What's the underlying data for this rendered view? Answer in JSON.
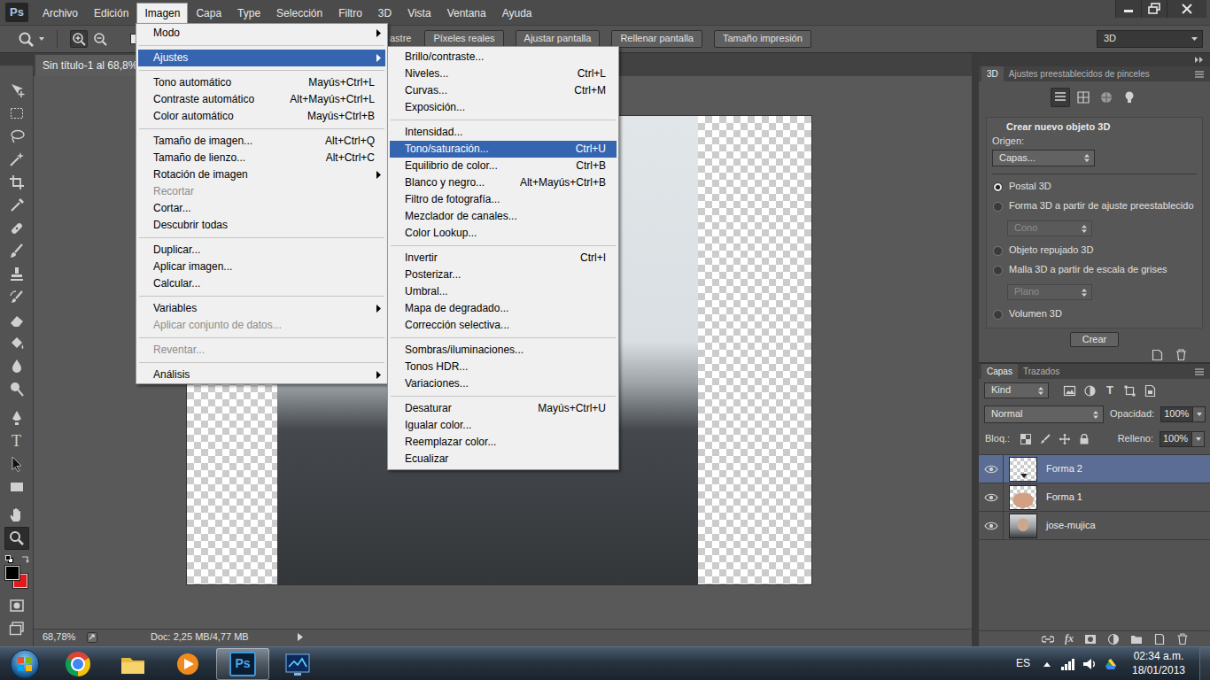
{
  "app": {
    "logo": "Ps"
  },
  "menubar": {
    "items": [
      {
        "label": "Archivo",
        "selected": false
      },
      {
        "label": "Edición",
        "selected": false
      },
      {
        "label": "Imagen",
        "selected": true
      },
      {
        "label": "Capa",
        "selected": false
      },
      {
        "label": "Type",
        "selected": false
      },
      {
        "label": "Selección",
        "selected": false
      },
      {
        "label": "Filtro",
        "selected": false
      },
      {
        "label": "3D",
        "selected": false
      },
      {
        "label": "Vista",
        "selected": false
      },
      {
        "label": "Ventana",
        "selected": false
      },
      {
        "label": "Ayuda",
        "selected": false
      }
    ]
  },
  "options_bar": {
    "resize_checkbox": {
      "checked": false
    },
    "cut_label": "astre",
    "buttons": [
      "Píxeles reales",
      "Ajustar pantalla",
      "Rellenar pantalla",
      "Tamaño impresión"
    ],
    "workspace": "3D"
  },
  "tools": {
    "items": [
      {
        "kind": "move",
        "selected": false
      },
      {
        "kind": "marquee",
        "selected": false
      },
      {
        "kind": "lasso",
        "selected": false
      },
      {
        "kind": "wand",
        "selected": false
      },
      {
        "kind": "crop",
        "selected": false
      },
      {
        "kind": "eyedropper",
        "selected": false
      },
      {
        "kind": "healing",
        "selected": false
      },
      {
        "kind": "brush",
        "selected": false
      },
      {
        "kind": "stamp",
        "selected": false
      },
      {
        "kind": "history",
        "selected": false
      },
      {
        "kind": "eraser",
        "selected": false
      },
      {
        "kind": "bucket",
        "selected": false
      },
      {
        "kind": "blur",
        "selected": false
      },
      {
        "kind": "dodge",
        "selected": false
      },
      {
        "kind": "pen",
        "selected": false
      },
      {
        "kind": "type",
        "glyph": "T",
        "selected": false
      },
      {
        "kind": "path-select",
        "selected": false
      },
      {
        "kind": "rectangle",
        "selected": false
      },
      {
        "kind": "hand",
        "selected": false
      },
      {
        "kind": "zoom",
        "selected": true
      }
    ],
    "swatches": [
      {
        "color": "#000000"
      },
      {
        "color": "#e3191c"
      }
    ]
  },
  "document": {
    "tab": "Sin título-1 al 68,8%",
    "zoom": "68,78%",
    "doc_size": "Doc: 2,25 MB/4,77 MB"
  },
  "panel_3d": {
    "tabs": [
      {
        "label": "3D",
        "selected": true
      },
      {
        "label": "Ajustes preestablecidos de pinceles",
        "selected": false
      }
    ],
    "source_buttons": [
      {
        "kind": "scene",
        "selected": true
      },
      {
        "kind": "mesh",
        "selected": false
      },
      {
        "kind": "material",
        "selected": false
      },
      {
        "kind": "light",
        "selected": false
      }
    ],
    "heading": "Crear nuevo objeto 3D",
    "source_label": "Origen:",
    "source_value": "Capas...",
    "options": [
      {
        "kind": "radio",
        "label": "Postal 3D",
        "selected": true
      },
      {
        "kind": "radio",
        "label": "Forma 3D a partir de ajuste preestablecido",
        "selected": false
      },
      {
        "kind": "dropdown",
        "label": "Cono",
        "disabled": true
      },
      {
        "kind": "radio",
        "label": "Objeto repujado 3D",
        "selected": false
      },
      {
        "kind": "radio",
        "label": "Malla 3D a partir de escala de grises",
        "selected": false
      },
      {
        "kind": "dropdown",
        "label": "Plano",
        "disabled": true
      },
      {
        "kind": "radio",
        "label": "Volumen 3D",
        "selected": false
      }
    ],
    "create_button": "Crear"
  },
  "layers_panel": {
    "tabs": [
      {
        "label": "Capas",
        "selected": true
      },
      {
        "label": "Trazados",
        "selected": false
      }
    ],
    "filter": "Kind",
    "type_filter_glyph": "T",
    "blend_mode": "Normal",
    "opacity_label": "Opacidad:",
    "opacity": "100%",
    "lock_label": "Bloq.:",
    "fill_label": "Relleno:",
    "fill": "100%",
    "layers": [
      {
        "name": "Forma 2",
        "kind": "vector",
        "visible": true,
        "selected": true
      },
      {
        "name": "Forma 1",
        "kind": "shape",
        "visible": true,
        "selected": false
      },
      {
        "name": "jose-mujica",
        "kind": "photo",
        "visible": true,
        "selected": false
      }
    ],
    "fx": "fx"
  },
  "image_menu": {
    "groups": [
      [
        {
          "label": "Modo",
          "submenu": true,
          "disabled": false,
          "selected": false
        }
      ],
      [
        {
          "label": "Ajustes",
          "submenu": true,
          "disabled": false,
          "selected": true
        }
      ],
      [
        {
          "label": "Tono automático",
          "shortcut": "Mayús+Ctrl+L",
          "submenu": false,
          "disabled": false,
          "selected": false
        },
        {
          "label": "Contraste automático",
          "shortcut": "Alt+Mayús+Ctrl+L",
          "submenu": false,
          "disabled": false,
          "selected": false
        },
        {
          "label": "Color automático",
          "shortcut": "Mayús+Ctrl+B",
          "submenu": false,
          "disabled": false,
          "selected": false
        }
      ],
      [
        {
          "label": "Tamaño de imagen...",
          "shortcut": "Alt+Ctrl+Q",
          "submenu": false,
          "disabled": false,
          "selected": false
        },
        {
          "label": "Tamaño de lienzo...",
          "shortcut": "Alt+Ctrl+C",
          "submenu": false,
          "disabled": false,
          "selected": false
        },
        {
          "label": "Rotación de imagen",
          "submenu": true,
          "disabled": false,
          "selected": false
        },
        {
          "label": "Recortar",
          "submenu": false,
          "disabled": true,
          "selected": false
        },
        {
          "label": "Cortar...",
          "submenu": false,
          "disabled": false,
          "selected": false
        },
        {
          "label": "Descubrir todas",
          "submenu": false,
          "disabled": false,
          "selected": false
        }
      ],
      [
        {
          "label": "Duplicar...",
          "submenu": false,
          "disabled": false,
          "selected": false
        },
        {
          "label": "Aplicar imagen...",
          "submenu": false,
          "disabled": false,
          "selected": false
        },
        {
          "label": "Calcular...",
          "submenu": false,
          "disabled": false,
          "selected": false
        }
      ],
      [
        {
          "label": "Variables",
          "submenu": true,
          "disabled": false,
          "selected": false
        },
        {
          "label": "Aplicar conjunto de datos...",
          "submenu": false,
          "disabled": true,
          "selected": false
        }
      ],
      [
        {
          "label": "Reventar...",
          "submenu": false,
          "disabled": true,
          "selected": false
        }
      ],
      [
        {
          "label": "Análisis",
          "submenu": true,
          "disabled": false,
          "selected": false
        }
      ]
    ]
  },
  "adjustments_menu": {
    "groups": [
      [
        {
          "label": "Brillo/contraste...",
          "submenu": false,
          "disabled": false,
          "selected": false
        },
        {
          "label": "Niveles...",
          "shortcut": "Ctrl+L",
          "submenu": false,
          "disabled": false,
          "selected": false
        },
        {
          "label": "Curvas...",
          "shortcut": "Ctrl+M",
          "submenu": false,
          "disabled": false,
          "selected": false
        },
        {
          "label": "Exposición...",
          "submenu": false,
          "disabled": false,
          "selected": false
        }
      ],
      [
        {
          "label": "Intensidad...",
          "submenu": false,
          "disabled": false,
          "selected": false
        },
        {
          "label": "Tono/saturación...",
          "shortcut": "Ctrl+U",
          "submenu": false,
          "disabled": false,
          "selected": true
        },
        {
          "label": "Equilibrio de color...",
          "shortcut": "Ctrl+B",
          "submenu": false,
          "disabled": false,
          "selected": false
        },
        {
          "label": "Blanco y negro...",
          "shortcut": "Alt+Mayús+Ctrl+B",
          "submenu": false,
          "disabled": false,
          "selected": false
        },
        {
          "label": "Filtro de fotografía...",
          "submenu": false,
          "disabled": false,
          "selected": false
        },
        {
          "label": "Mezclador de canales...",
          "submenu": false,
          "disabled": false,
          "selected": false
        },
        {
          "label": "Color Lookup...",
          "submenu": false,
          "disabled": false,
          "selected": false
        }
      ],
      [
        {
          "label": "Invertir",
          "shortcut": "Ctrl+I",
          "submenu": false,
          "disabled": false,
          "selected": false
        },
        {
          "label": "Posterizar...",
          "submenu": false,
          "disabled": false,
          "selected": false
        },
        {
          "label": "Umbral...",
          "submenu": false,
          "disabled": false,
          "selected": false
        },
        {
          "label": "Mapa de degradado...",
          "submenu": false,
          "disabled": false,
          "selected": false
        },
        {
          "label": "Corrección selectiva...",
          "submenu": false,
          "disabled": false,
          "selected": false
        }
      ],
      [
        {
          "label": "Sombras/iluminaciones...",
          "submenu": false,
          "disabled": false,
          "selected": false
        },
        {
          "label": "Tonos HDR...",
          "submenu": false,
          "disabled": false,
          "selected": false
        },
        {
          "label": "Variaciones...",
          "submenu": false,
          "disabled": false,
          "selected": false
        }
      ],
      [
        {
          "label": "Desaturar",
          "shortcut": "Mayús+Ctrl+U",
          "submenu": false,
          "disabled": false,
          "selected": false
        },
        {
          "label": "Igualar color...",
          "submenu": false,
          "disabled": false,
          "selected": false
        },
        {
          "label": "Reemplazar color...",
          "submenu": false,
          "disabled": false,
          "selected": false
        },
        {
          "label": "Ecualizar",
          "submenu": false,
          "disabled": false,
          "selected": false
        }
      ]
    ]
  },
  "taskbar": {
    "apps": [
      {
        "kind": "chrome",
        "selected": false
      },
      {
        "kind": "explorer",
        "selected": false
      },
      {
        "kind": "media",
        "selected": false
      },
      {
        "kind": "photoshop",
        "label": "Ps",
        "selected": true
      },
      {
        "kind": "monitor",
        "selected": false
      }
    ],
    "language": "ES",
    "time": "02:34 a.m.",
    "date": "18/01/2013"
  }
}
